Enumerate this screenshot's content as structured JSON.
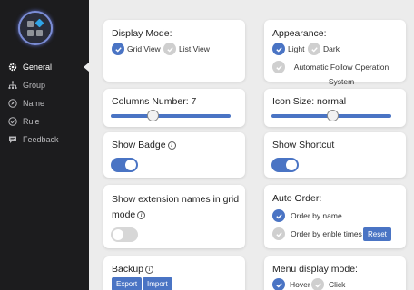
{
  "sidebar": {
    "items": [
      {
        "label": "General",
        "icon": "gear-icon"
      },
      {
        "label": "Group",
        "icon": "hierarchy-icon"
      },
      {
        "label": "Name",
        "icon": "compass-icon"
      },
      {
        "label": "Rule",
        "icon": "check-circle-icon"
      },
      {
        "label": "Feedback",
        "icon": "chat-icon"
      }
    ]
  },
  "display_mode": {
    "title": "Display Mode:",
    "options": [
      "Grid View",
      "List View"
    ],
    "selected": "Grid View"
  },
  "appearance": {
    "title": "Appearance:",
    "options": [
      "Light",
      "Dark",
      "Automatic Follow Operation System"
    ],
    "selected": "Light"
  },
  "columns": {
    "title": "Columns Number: 7",
    "value": 7,
    "fraction": 0.35
  },
  "icon_size": {
    "title": "Icon Size: normal",
    "fraction": 0.5
  },
  "show_badge": {
    "title": "Show Badge",
    "enabled": true
  },
  "show_shortcut": {
    "title": "Show Shortcut",
    "enabled": true
  },
  "ext_names": {
    "title_line1": "Show extension names in grid",
    "title_line2": "mode",
    "enabled": false
  },
  "auto_order": {
    "title": "Auto Order:",
    "options": [
      "Order by name",
      "Order by enble times"
    ],
    "selected": "Order by name",
    "reset_label": "Reset"
  },
  "backup": {
    "title": "Backup",
    "export_label": "Export",
    "import_label": "Import"
  },
  "menu_mode": {
    "title": "Menu display mode:",
    "options": [
      "Hover",
      "Click"
    ],
    "selected": "Hover"
  },
  "colors": {
    "accent": "#4a74c4",
    "sidebar": "#1c1c1e",
    "bg": "#ececec"
  }
}
